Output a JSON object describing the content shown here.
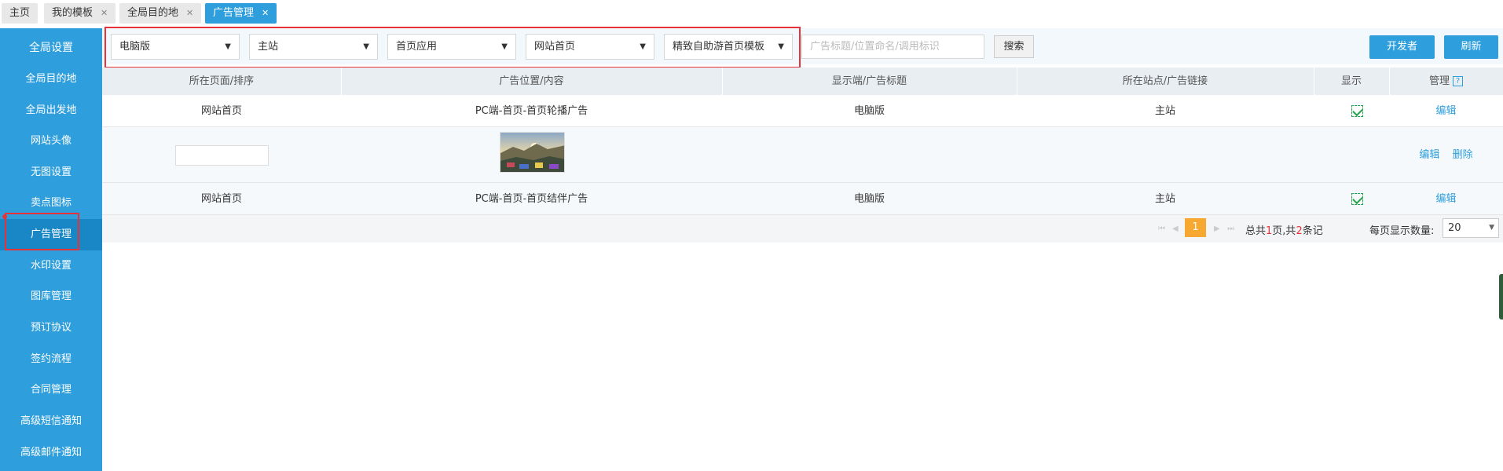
{
  "tabs": [
    {
      "label": "主页",
      "closable": false,
      "active": false
    },
    {
      "label": "我的模板",
      "closable": true,
      "active": false
    },
    {
      "label": "全局目的地",
      "closable": true,
      "active": false
    },
    {
      "label": "广告管理",
      "closable": true,
      "active": true
    }
  ],
  "sidebar": {
    "items": [
      {
        "label": "全局设置"
      },
      {
        "label": "全局目的地"
      },
      {
        "label": "全局出发地"
      },
      {
        "label": "网站头像"
      },
      {
        "label": "无图设置"
      },
      {
        "label": "卖点图标"
      },
      {
        "label": "广告管理",
        "active": true
      },
      {
        "label": "水印设置"
      },
      {
        "label": "图库管理"
      },
      {
        "label": "预订协议"
      },
      {
        "label": "签约流程"
      },
      {
        "label": "合同管理"
      },
      {
        "label": "高级短信通知"
      },
      {
        "label": "高级邮件通知"
      }
    ]
  },
  "filters": {
    "platform": "电脑版",
    "site": "主站",
    "app": "首页应用",
    "page": "网站首页",
    "template": "精致自助游首页模板",
    "search_placeholder": "广告标题/位置命名/调用标识",
    "search_label": "搜索",
    "developer_label": "开发者",
    "refresh_label": "刷新"
  },
  "table": {
    "headers": [
      "所在页面/排序",
      "广告位置/内容",
      "显示端/广告标题",
      "所在站点/广告链接",
      "显示",
      "管理"
    ],
    "rows": [
      {
        "page": "网站首页",
        "position": "PC端-首页-首页轮播广告",
        "terminal": "电脑版",
        "site": "主站",
        "shown": true,
        "edit": "编辑"
      },
      {
        "sub": true,
        "edit": "编辑",
        "delete": "删除",
        "image": "landscape-thumbnail"
      },
      {
        "page": "网站首页",
        "position": "PC端-首页-首页结伴广告",
        "terminal": "电脑版",
        "site": "主站",
        "shown": true,
        "edit": "编辑"
      }
    ]
  },
  "pagination": {
    "current_page": "1",
    "prefix": "总共",
    "total_pages": "1",
    "middle": "页,共",
    "total_records": "2",
    "suffix": "条记",
    "per_page_label": "每页显示数量:",
    "per_page": "20"
  },
  "colors": {
    "accent": "#2e9edc",
    "highlight": "#e8323a",
    "page_active": "#f7a830",
    "check": "#27a34b"
  }
}
